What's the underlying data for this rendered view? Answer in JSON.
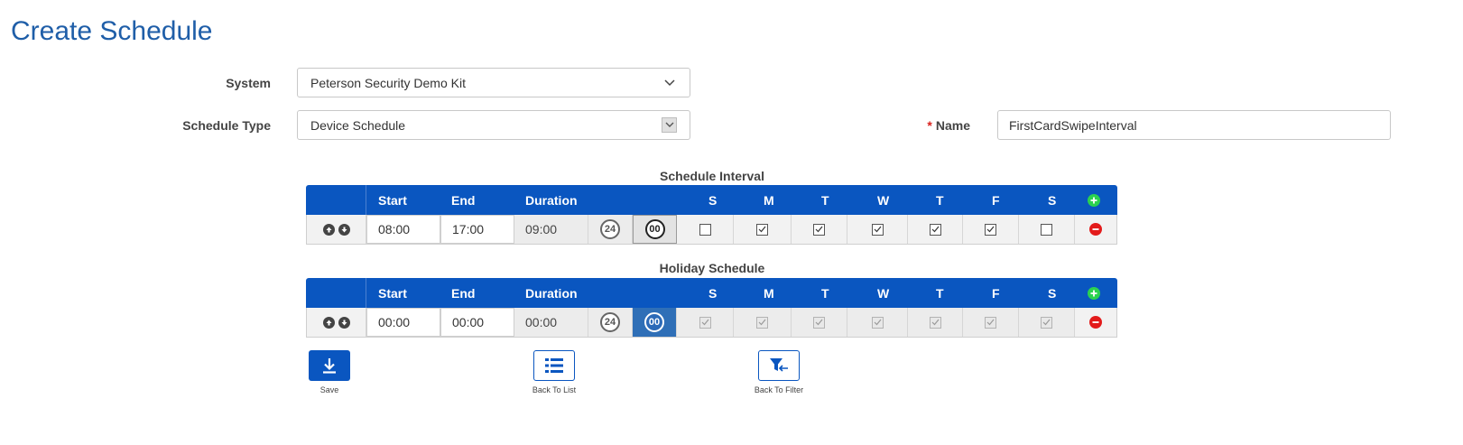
{
  "page": {
    "title": "Create Schedule"
  },
  "form": {
    "system_label": "System",
    "system_value": "Peterson Security Demo Kit",
    "schedule_type_label": "Schedule Type",
    "schedule_type_value": "Device Schedule",
    "name_required_mark": "*",
    "name_label": "Name",
    "name_value": "FirstCardSwipeInterval"
  },
  "schedule_interval": {
    "title": "Schedule Interval",
    "headers": {
      "start": "Start",
      "end": "End",
      "duration": "Duration",
      "days": [
        "S",
        "M",
        "T",
        "W",
        "T",
        "F",
        "S"
      ]
    },
    "row": {
      "start": "08:00",
      "end": "17:00",
      "duration": "09:00",
      "btn_24": "24",
      "btn_00": "00",
      "days_checked": [
        false,
        true,
        true,
        true,
        true,
        true,
        false
      ]
    }
  },
  "holiday_schedule": {
    "title": "Holiday Schedule",
    "headers": {
      "start": "Start",
      "end": "End",
      "duration": "Duration",
      "days": [
        "S",
        "M",
        "T",
        "W",
        "T",
        "F",
        "S"
      ]
    },
    "row": {
      "start": "00:00",
      "end": "00:00",
      "duration": "00:00",
      "btn_24": "24",
      "btn_00": "00",
      "days_checked": [
        true,
        true,
        true,
        true,
        true,
        true,
        true
      ]
    }
  },
  "actions": {
    "save": "Save",
    "back_to_list": "Back To List",
    "back_to_filter": "Back To Filter"
  },
  "colors": {
    "primary": "#0a56c0",
    "title": "#1f5ea8",
    "add": "#2bd24f",
    "remove": "#e31b1b",
    "required": "#d9211d"
  },
  "icons": [
    "chevron-down-icon",
    "arrow-up-icon",
    "arrow-down-icon",
    "plus-icon",
    "minus-icon",
    "checkbox-icon",
    "download-icon",
    "list-icon",
    "filter-back-icon"
  ]
}
